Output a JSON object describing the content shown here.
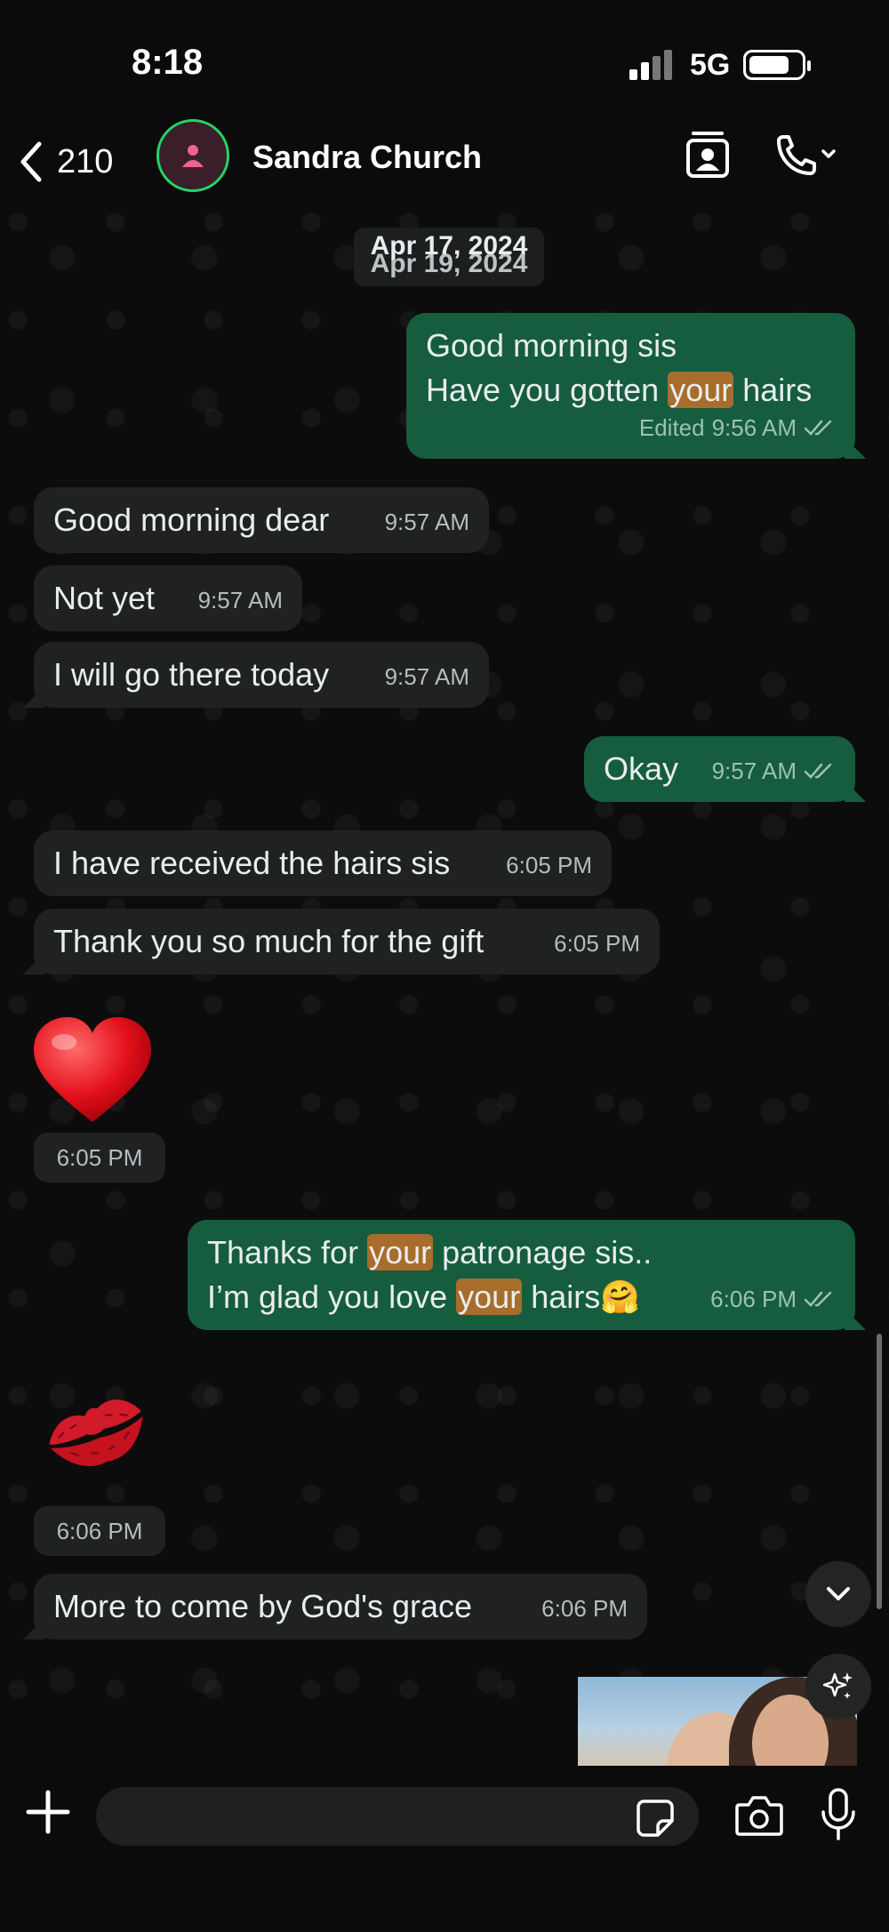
{
  "status_bar": {
    "time": "8:18",
    "network": "5G"
  },
  "header": {
    "back_count": "210",
    "contact_name": "Sandra Church"
  },
  "date_chip": {
    "primary": "Apr 17, 2024",
    "secondary": "Apr 19, 2024"
  },
  "messages": [
    {
      "dir": "out",
      "lines": [
        "Good morning sis",
        "Have you gotten ",
        "your",
        " hairs"
      ],
      "time": "9:56 AM",
      "edited": "Edited"
    },
    {
      "dir": "in",
      "text": "Good morning dear",
      "time": "9:57 AM"
    },
    {
      "dir": "in",
      "text": "Not yet",
      "time": "9:57 AM"
    },
    {
      "dir": "in",
      "text": "I will go there today",
      "time": "9:57 AM"
    },
    {
      "dir": "out",
      "text": "Okay",
      "time": "9:57 AM"
    },
    {
      "dir": "in",
      "text": "I have received the hairs sis",
      "time": "6:05 PM"
    },
    {
      "dir": "in",
      "text": "Thank you so much for the gift",
      "time": "6:05 PM"
    },
    {
      "dir": "in",
      "emoji": "heart",
      "time": "6:05 PM"
    },
    {
      "dir": "out",
      "lines": [
        "Thanks for ",
        "your",
        " patronage sis..",
        "I’m glad you love ",
        "your",
        " hairs",
        "🤗"
      ],
      "time": "6:06 PM"
    },
    {
      "dir": "in",
      "emoji": "kiss",
      "time": "6:06 PM"
    },
    {
      "dir": "in",
      "text": "More to come by God's grace",
      "time": "6:06 PM"
    }
  ],
  "input": {
    "placeholder": ""
  },
  "colors": {
    "outgoing": "#155d3e",
    "incoming": "#202222",
    "highlight": "#a86d2b",
    "accent": "#25d366"
  }
}
